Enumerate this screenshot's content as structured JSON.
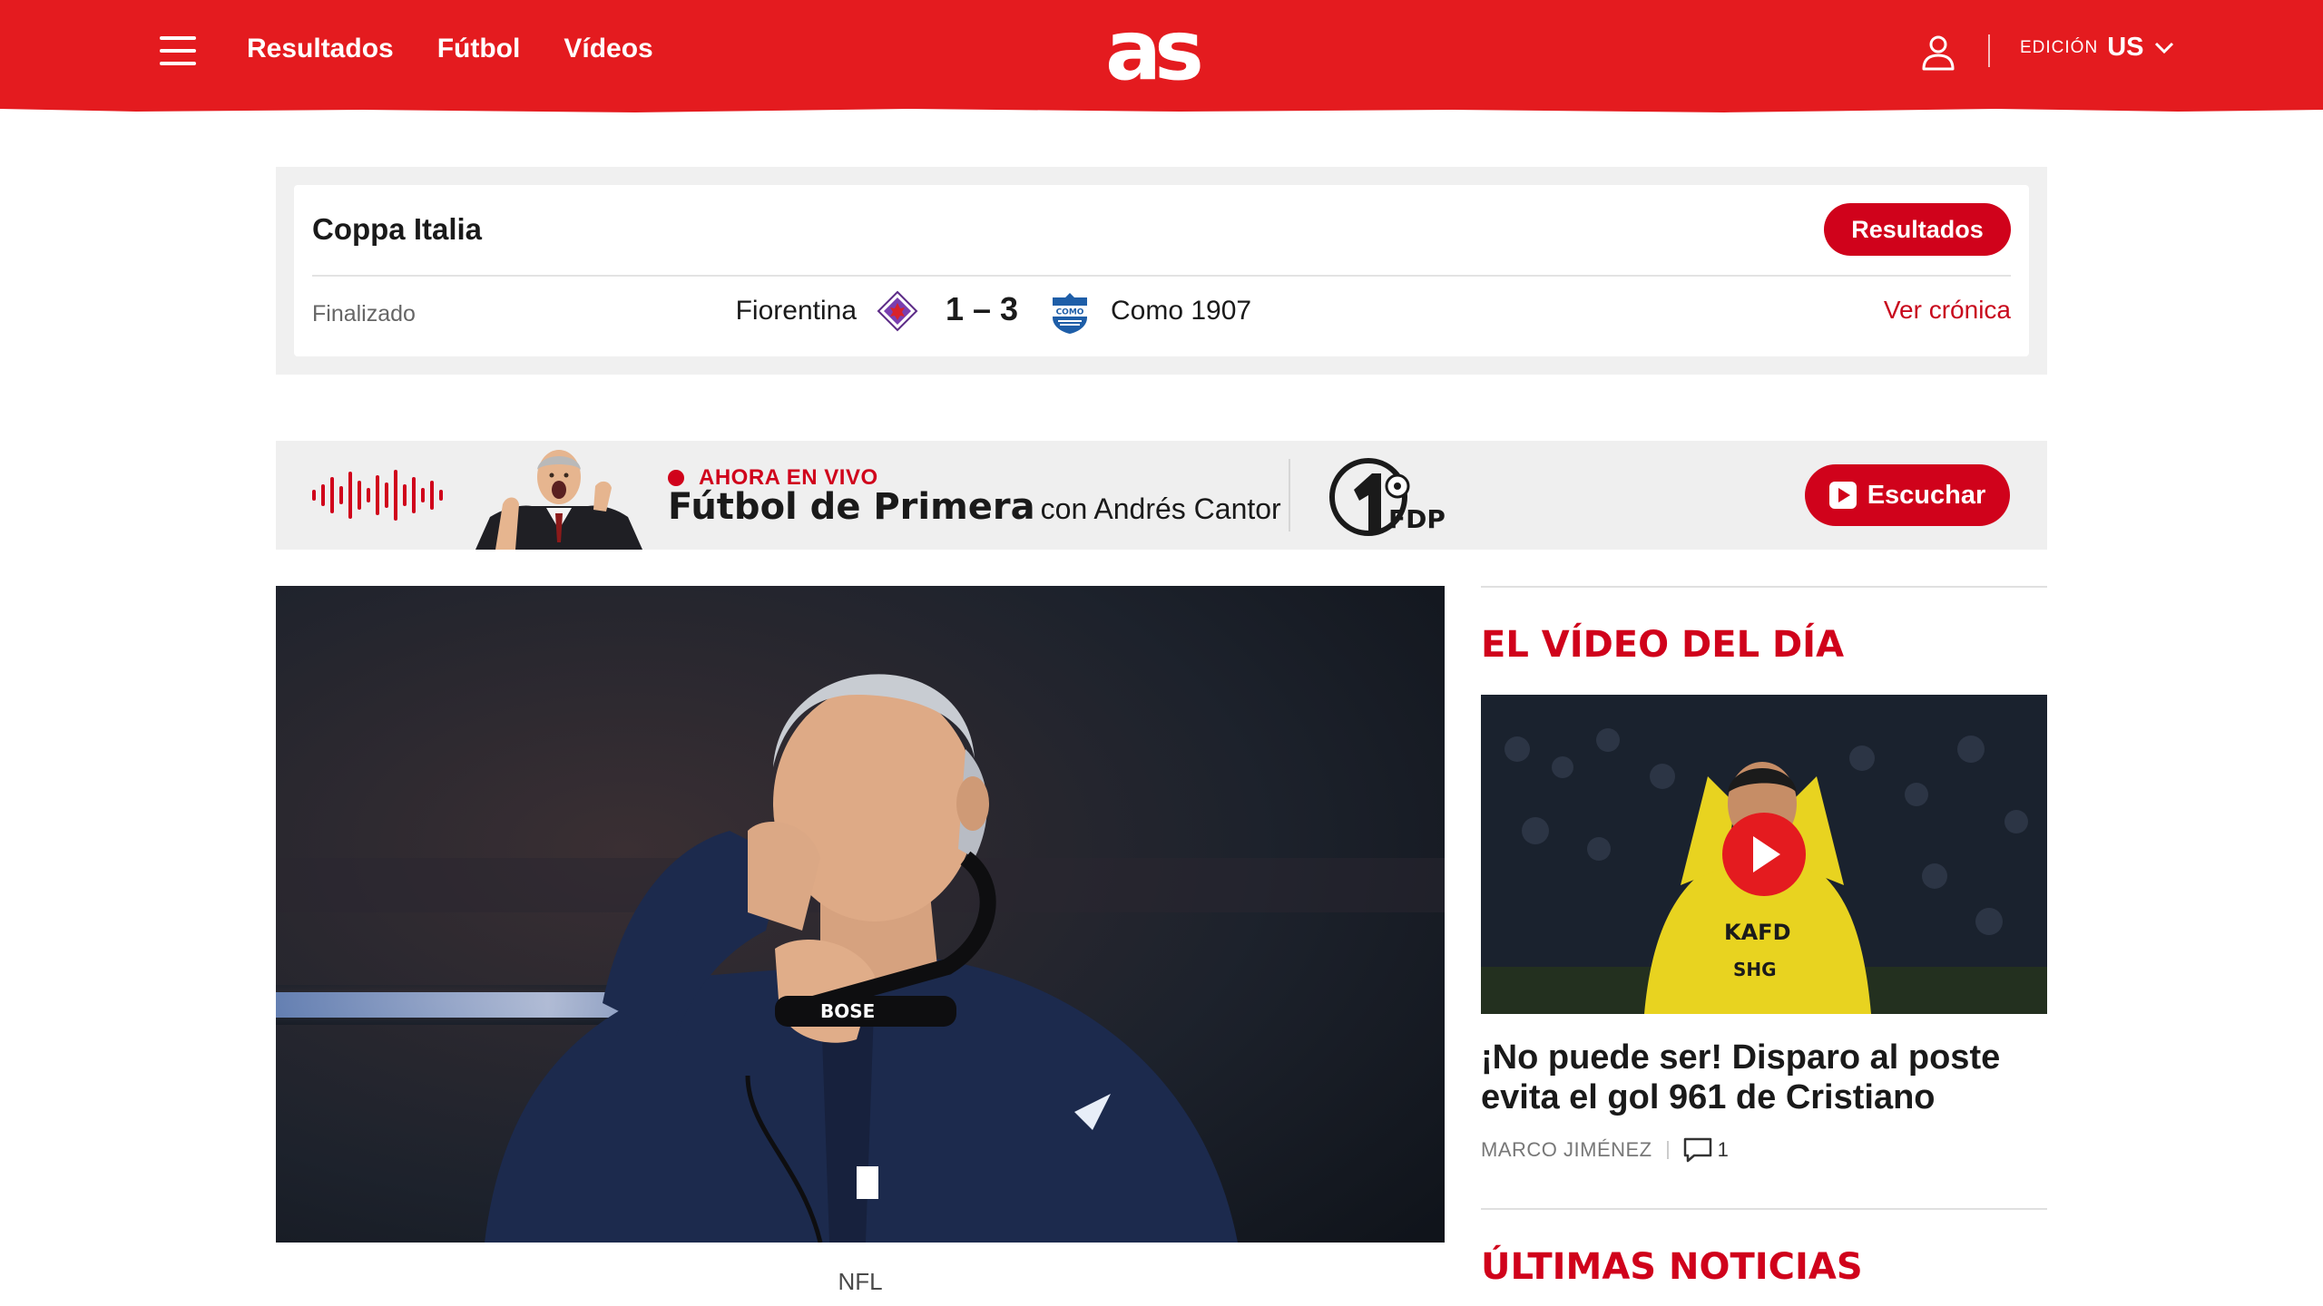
{
  "header": {
    "logo": "as",
    "nav": [
      "Resultados",
      "Fútbol",
      "Vídeos"
    ],
    "edition_label": "EDICIÓN",
    "edition_value": "US",
    "icons": [
      "menu-icon",
      "user-icon",
      "chevron-down-icon"
    ]
  },
  "scoreboard": {
    "competition": "Coppa Italia",
    "results_button": "Resultados",
    "status": "Finalizado",
    "home_team": "Fiorentina",
    "away_team": "Como 1907",
    "score": "1 – 3",
    "report_link": "Ver crónica"
  },
  "live_banner": {
    "live_label": "AHORA EN VIVO",
    "show_title": "Fútbol de Primera",
    "show_host": "con Andrés Cantor",
    "partner_logo": "FDP",
    "listen_button": "Escuchar"
  },
  "hero": {
    "caption": "NFL"
  },
  "sidebar": {
    "video_section_title": "EL VÍDEO DEL DÍA",
    "video_headline": "¡No puede ser! Disparo al poste evita el gol 961 de Cristiano",
    "video_author": "MARCO JIMÉNEZ",
    "video_comments": "1",
    "news_section_title": "ÚLTIMAS NOTICIAS"
  },
  "colors": {
    "brand_red": "#e41b1f",
    "accent_red": "#d0021b"
  }
}
